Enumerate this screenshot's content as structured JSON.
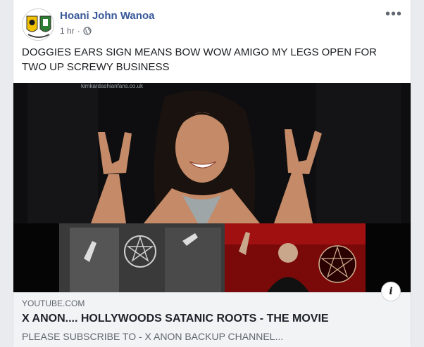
{
  "post": {
    "author": "Hoani John Wanoa",
    "time": "1 hr",
    "privacy_icon": "globe-icon",
    "more_label": "•••",
    "text": "DOGGIES EARS SIGN MEANS BOW WOW AMIGO MY LEGS OPEN FOR TWO UP SCREWY BUSINESS"
  },
  "media": {
    "watermark": "kimkardashianfans.co.uk"
  },
  "link": {
    "domain": "YOUTUBE.COM",
    "title": "X ANON.... HOLLYWOODS SATANIC ROOTS - THE MOVIE",
    "description": "PLEASE SUBSCRIBE TO - X ANON BACKUP CHANNEL...",
    "info_label": "i"
  },
  "colors": {
    "author": "#385898",
    "background": "#e9ebee",
    "link_box": "#f2f3f5"
  }
}
